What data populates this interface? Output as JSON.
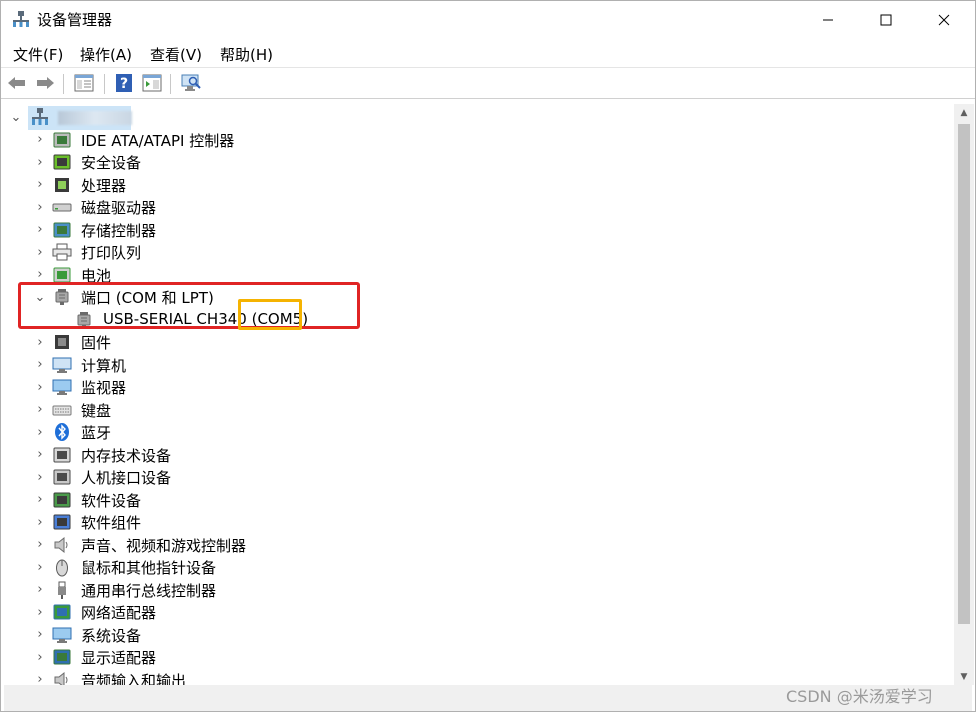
{
  "window": {
    "title": "设备管理器",
    "minimize": "minimize",
    "maximize": "maximize",
    "close": "close"
  },
  "menu": [
    {
      "label": "文件(F)"
    },
    {
      "label": "操作(A)"
    },
    {
      "label": "查看(V)"
    },
    {
      "label": "帮助(H)"
    }
  ],
  "toolbar": {
    "icons": [
      "back-arrow-icon",
      "forward-arrow-icon",
      "show-hide-console-tree-icon",
      "help-icon",
      "properties-icon",
      "scan-hardware-icon"
    ]
  },
  "tree": {
    "root_label": "",
    "categories": [
      {
        "label": "IDE ATA/ATAPI 控制器",
        "icon": "ide-controller-icon",
        "expanded": false
      },
      {
        "label": "安全设备",
        "icon": "security-device-icon",
        "expanded": false
      },
      {
        "label": "处理器",
        "icon": "processor-icon",
        "expanded": false
      },
      {
        "label": "磁盘驱动器",
        "icon": "disk-drive-icon",
        "expanded": false
      },
      {
        "label": "存储控制器",
        "icon": "storage-controller-icon",
        "expanded": false
      },
      {
        "label": "打印队列",
        "icon": "printer-icon",
        "expanded": false
      },
      {
        "label": "电池",
        "icon": "battery-icon",
        "expanded": false
      },
      {
        "label": "端口 (COM 和 LPT)",
        "icon": "port-icon",
        "expanded": true,
        "children": [
          {
            "label": "USB-SERIAL CH340 (COM5)",
            "icon": "port-icon"
          }
        ]
      },
      {
        "label": "固件",
        "icon": "firmware-icon",
        "expanded": false
      },
      {
        "label": "计算机",
        "icon": "computer-icon",
        "expanded": false
      },
      {
        "label": "监视器",
        "icon": "monitor-icon",
        "expanded": false
      },
      {
        "label": "键盘",
        "icon": "keyboard-icon",
        "expanded": false
      },
      {
        "label": "蓝牙",
        "icon": "bluetooth-icon",
        "expanded": false
      },
      {
        "label": "内存技术设备",
        "icon": "memory-device-icon",
        "expanded": false
      },
      {
        "label": "人机接口设备",
        "icon": "hid-icon",
        "expanded": false
      },
      {
        "label": "软件设备",
        "icon": "software-device-icon",
        "expanded": false
      },
      {
        "label": "软件组件",
        "icon": "software-component-icon",
        "expanded": false
      },
      {
        "label": "声音、视频和游戏控制器",
        "icon": "audio-icon",
        "expanded": false
      },
      {
        "label": "鼠标和其他指针设备",
        "icon": "mouse-icon",
        "expanded": false
      },
      {
        "label": "通用串行总线控制器",
        "icon": "usb-icon",
        "expanded": false
      },
      {
        "label": "网络适配器",
        "icon": "network-adapter-icon",
        "expanded": false
      },
      {
        "label": "系统设备",
        "icon": "system-device-icon",
        "expanded": false
      },
      {
        "label": "显示适配器",
        "icon": "display-adapter-icon",
        "expanded": false
      },
      {
        "label": "音频输入和输出",
        "icon": "audio-io-icon",
        "expanded": false
      }
    ]
  },
  "annotations": {
    "highlight_colors": {
      "ports_box": "#e02424",
      "com_box": "#f5b301"
    }
  },
  "watermark": "CSDN @米汤爱学习"
}
